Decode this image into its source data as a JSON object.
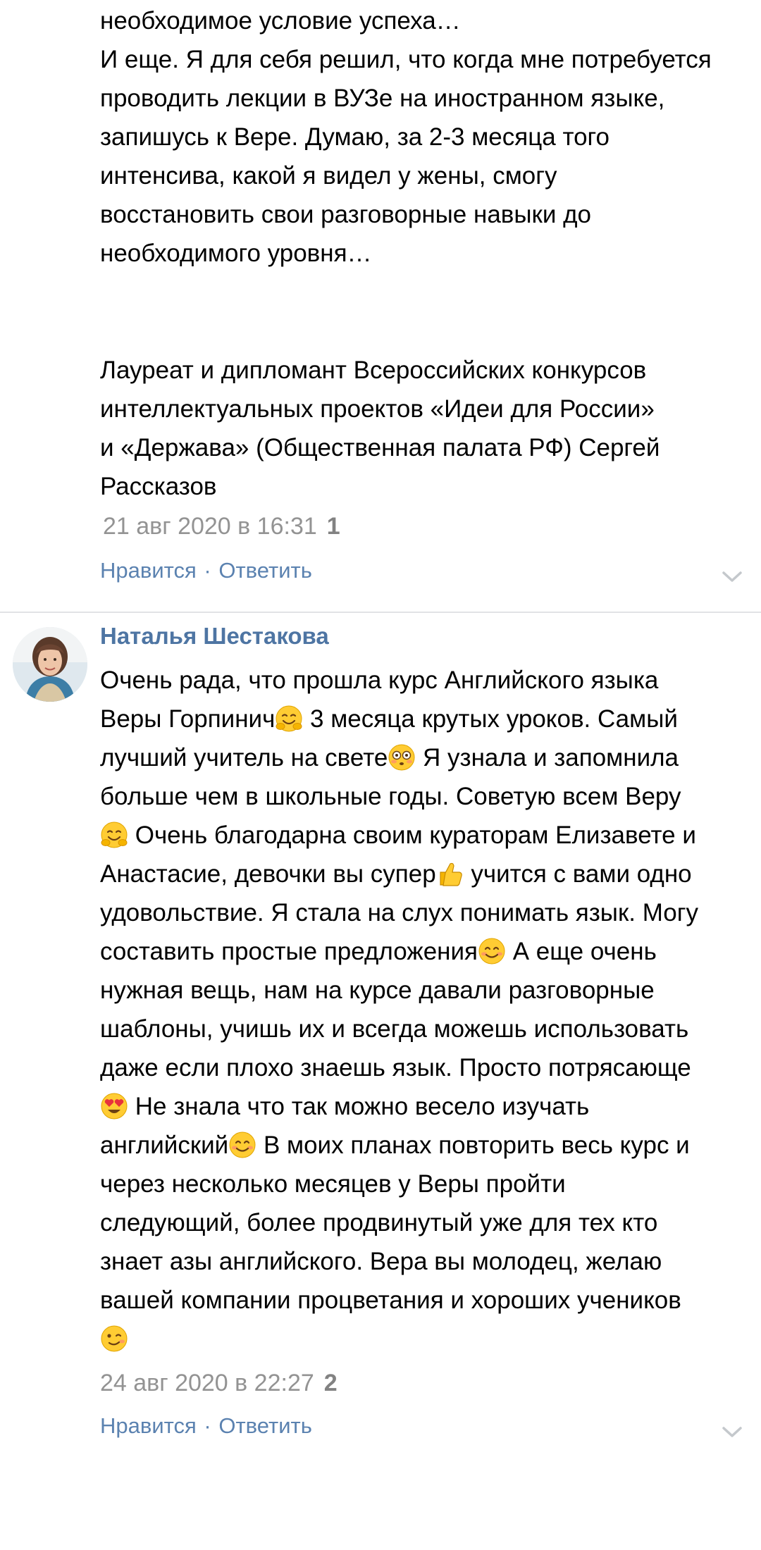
{
  "comment1": {
    "text_lines": [
      "необходимое условие успеха…",
      "И еще. Я для себя решил, что когда мне потребуется",
      "проводить лекции в ВУЗе на иностранном языке,",
      "запишусь к Вере. Думаю, за 2-3 месяца того",
      "интенсива, какой я видел у жены, смогу",
      "восстановить свои разговорные навыки до",
      "необходимого уровня…"
    ],
    "signature_lines": [
      "Лауреат и дипломант Всероссийских конкурсов",
      "интеллектуальных проектов «Идеи для России»",
      "и «Держава» (Общественная палата РФ) Сергей",
      "Рассказов"
    ],
    "date": "21 авг 2020 в 16:31",
    "likes": "1",
    "like_label": "Нравится",
    "separator": "·",
    "reply_label": "Ответить"
  },
  "comment2": {
    "author": "Наталья Шестакова",
    "segments": [
      {
        "t": "Очень рада, что прошла курс Английского языка\nВеры Горпинич"
      },
      {
        "e": "hugging-face-emoji"
      },
      {
        "t": " 3 месяца крутых уроков. Самый\nлучший учитель на свете"
      },
      {
        "e": "flushed-face-emoji"
      },
      {
        "t": " Я узнала и запомнила\nбольше чем в школьные годы. Советую всем Веру\n"
      },
      {
        "e": "hugging-face-emoji"
      },
      {
        "t": " Очень благодарна своим кураторам Елизавете и\nАнастасие, девочки вы супер"
      },
      {
        "e": "thumbs-up-emoji"
      },
      {
        "t": " учится с вами одно\nудовольствие. Я стала на слух понимать язык. Могу\nсоставить простые предложения"
      },
      {
        "e": "smiling-face-emoji"
      },
      {
        "t": " А еще очень\nнужная вещь, нам на курсе давали разговорные\nшаблоны, учишь их и всегда можешь использовать\nдаже если плохо знаешь язык. Просто потрясающе\n"
      },
      {
        "e": "heart-eyes-emoji"
      },
      {
        "t": " Не знала что так можно весело изучать\nанглийский"
      },
      {
        "e": "smiling-face-emoji"
      },
      {
        "t": " В моих планах повторить весь курс и\nчерез несколько месяцев у Веры пройти\nследующий, более продвинутый уже для тех кто\nзнает азы английского. Вера вы молодец, желаю\nвашей компании процветания и хороших учеников\n"
      },
      {
        "e": "winking-face-emoji"
      }
    ],
    "date": "24 авг 2020 в 22:27",
    "likes": "2",
    "like_label": "Нравится",
    "separator": "·",
    "reply_label": "Ответить"
  },
  "colors": {
    "link": "#5b82b0",
    "author": "#4e75a3",
    "meta": "#939393",
    "divider": "#e1e3e6"
  }
}
